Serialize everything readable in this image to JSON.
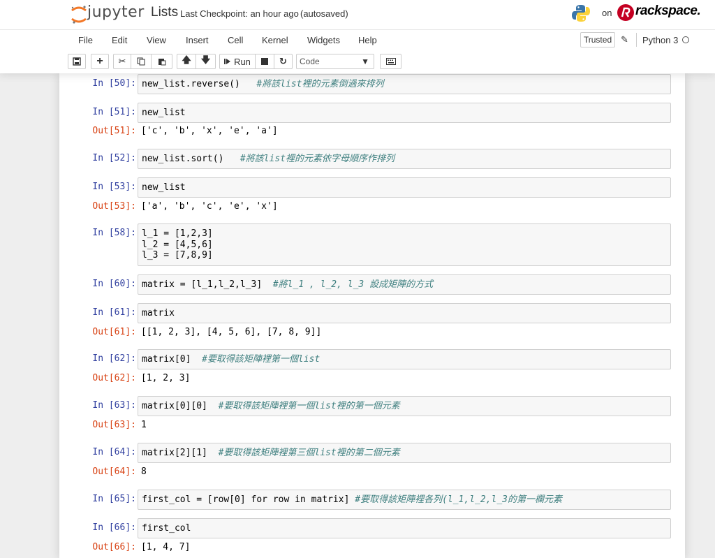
{
  "header": {
    "logo_text": "jupyter",
    "notebook_title": "Lists",
    "checkpoint": "Last Checkpoint: an hour ago",
    "autosave": "(autosaved)",
    "on_label": "on",
    "host_brand": "rackspace."
  },
  "menu": [
    "File",
    "Edit",
    "View",
    "Insert",
    "Cell",
    "Kernel",
    "Widgets",
    "Help"
  ],
  "status": {
    "trusted": "Trusted",
    "kernel": "Python 3"
  },
  "toolbar": {
    "run_label": "Run",
    "cell_type": "Code"
  },
  "cells": [
    {
      "in_prompt": "In [50]:",
      "code": "new_list.reverse()",
      "comment": "#將該list裡的元素倒過來排列"
    },
    {
      "in_prompt": "In [51]:",
      "code": "new_list",
      "out_prompt": "Out[51]:",
      "output": "['c', 'b', 'x', 'e', 'a']"
    },
    {
      "in_prompt": "In [52]:",
      "code": "new_list.sort()",
      "comment": "#將該list裡的元素依字母順序作排列"
    },
    {
      "in_prompt": "In [53]:",
      "code": "new_list",
      "out_prompt": "Out[53]:",
      "output": "['a', 'b', 'c', 'e', 'x']"
    },
    {
      "in_prompt": "In [58]:",
      "lines": [
        "l_1 = [1,2,3]",
        "l_2 = [4,5,6]",
        "l_3 = [7,8,9]"
      ]
    },
    {
      "in_prompt": "In [60]:",
      "code": "matrix = [l_1,l_2,l_3]",
      "comment": "#將l_1 , l_2, l_3 設成矩陣的方式"
    },
    {
      "in_prompt": "In [61]:",
      "code": "matrix",
      "out_prompt": "Out[61]:",
      "output": "[[1, 2, 3], [4, 5, 6], [7, 8, 9]]"
    },
    {
      "in_prompt": "In [62]:",
      "code": "matrix[0]",
      "comment": "#要取得該矩陣裡第一個list",
      "out_prompt": "Out[62]:",
      "output": "[1, 2, 3]"
    },
    {
      "in_prompt": "In [63]:",
      "code": "matrix[0][0]",
      "comment": "#要取得該矩陣裡第一個list裡的第一個元素",
      "out_prompt": "Out[63]:",
      "output": "1"
    },
    {
      "in_prompt": "In [64]:",
      "code": "matrix[2][1]",
      "comment": "#要取得該矩陣裡第三個list裡的第二個元素",
      "out_prompt": "Out[64]:",
      "output": "8"
    },
    {
      "in_prompt": "In [65]:",
      "code": "first_col = [row[0] for row in matrix]",
      "comment": "#要取得該矩陣裡各列(l_1,l_2,l_3的第一欄元素"
    },
    {
      "in_prompt": "In [66]:",
      "code": "first_col",
      "out_prompt": "Out[66]:",
      "output": "[1, 4, 7]"
    }
  ]
}
